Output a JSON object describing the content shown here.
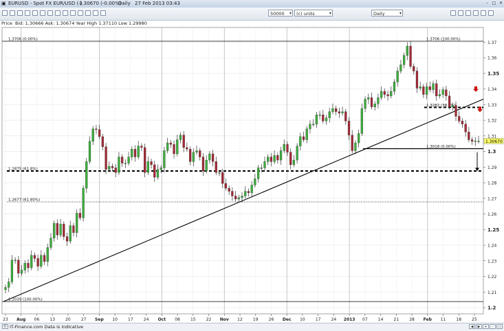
{
  "window": {
    "title": "EURUSD - Spot FX EUR/USD (-)",
    "price_info": "1.30670 (-0.00%)",
    "timeframe": "Daily",
    "datetime": "27 Feb 2013 03:43"
  },
  "toolbar": {
    "quantity_value": "50000",
    "units_value": "(c) units",
    "interval_value": "Daily"
  },
  "infobar": {
    "price_label": "Price",
    "quote_text": "Bid: 1.30666 Ask: 1.30674 Year High 1.37110 Low 1.29980"
  },
  "footer": {
    "source_text": "IT-Finance.com  Data is indicative"
  },
  "colors": {
    "up_candle": "#3dae3d",
    "down_candle": "#a42a36",
    "price_tag": "#ffff66",
    "arrow": "#cc1111"
  },
  "chart_data": {
    "type": "candlestick",
    "ylim": [
      1.2,
      1.375
    ],
    "yticks": [
      "1.37",
      "1.36",
      "1.35",
      "1.34",
      "1.33",
      "1.32",
      "1.31",
      "1.3",
      "1.29",
      "1.28",
      "1.27",
      "1.26",
      "1.25",
      "1.24",
      "1.23",
      "1.22",
      "1.21",
      "1.2"
    ],
    "bold_yticks": [
      "1.35",
      "1.3",
      "1.25",
      "1.2"
    ],
    "x_labels": [
      "23",
      "Aug",
      "06",
      "13",
      "20",
      "27",
      "Sep",
      "10",
      "17",
      "24",
      "Oct",
      "08",
      "15",
      "22",
      "Nov",
      "12",
      "19",
      "26",
      "Dec",
      "10",
      "17",
      "24",
      "2013",
      "07",
      "14",
      "21",
      "28",
      "Feb",
      "11",
      "18",
      "25"
    ],
    "last_price": "1.30670",
    "candles": {
      "open": [
        1.2115,
        1.213,
        1.2165,
        1.2305,
        1.2305,
        1.222,
        1.224,
        1.2285,
        1.2255,
        1.2335,
        1.2315,
        1.2265,
        1.2335,
        1.2295,
        1.2385,
        1.2445,
        1.254,
        1.2465,
        1.2535,
        1.2455,
        1.2425,
        1.2525,
        1.248,
        1.2605,
        1.2575,
        1.2765,
        1.2935,
        1.3065,
        1.3145,
        1.314,
        1.3095,
        1.303,
        1.2885,
        1.2905,
        1.2895,
        1.2865,
        1.2965,
        1.2925,
        1.2925,
        1.2965,
        1.3015,
        1.2965,
        1.3035,
        1.3025,
        1.2865,
        1.2935,
        1.2915,
        1.2835,
        1.2885,
        1.2895,
        1.3005,
        1.3055,
        1.3045,
        1.2985,
        1.3075,
        1.3105,
        1.3025,
        1.3015,
        1.2935,
        1.2995,
        1.3005,
        1.2965,
        1.2875,
        1.2945,
        1.2985,
        1.2935,
        1.2865,
        1.2865,
        1.2795,
        1.2765,
        1.2745,
        1.2715,
        1.2695,
        1.2705,
        1.2715,
        1.2745,
        1.2735,
        1.2785,
        1.2825,
        1.2895,
        1.2895,
        1.2935,
        1.2965,
        1.2935,
        1.2975,
        1.2945,
        1.3005,
        1.3045,
        1.2995,
        1.2915,
        1.2945,
        1.3035,
        1.3095,
        1.3075,
        1.3145,
        1.3175,
        1.3175,
        1.3235,
        1.3235,
        1.3195,
        1.3215,
        1.3255,
        1.3275,
        1.3255,
        1.3245,
        1.3255,
        1.3195,
        1.3105,
        1.3005,
        1.3055,
        1.3115,
        1.3275,
        1.3335,
        1.3345,
        1.3285,
        1.3305,
        1.3345,
        1.3385,
        1.3365,
        1.3355,
        1.3385,
        1.3445,
        1.3515,
        1.3555,
        1.3615,
        1.3675,
        1.3545,
        1.3515,
        1.3405,
        1.3415,
        1.3365,
        1.3415,
        1.3395,
        1.3435,
        1.3355,
        1.3365,
        1.3395,
        1.3355,
        1.3285,
        1.3295,
        1.3225,
        1.3195,
        1.3175,
        1.3125,
        1.3075,
        1.3065,
        1.3067
      ],
      "close": [
        1.213,
        1.2165,
        1.2305,
        1.2305,
        1.222,
        1.224,
        1.2285,
        1.2255,
        1.2335,
        1.2315,
        1.2265,
        1.2335,
        1.2295,
        1.2385,
        1.2445,
        1.254,
        1.2465,
        1.2535,
        1.2455,
        1.2425,
        1.2525,
        1.248,
        1.2605,
        1.2575,
        1.2765,
        1.2935,
        1.3065,
        1.3145,
        1.314,
        1.3095,
        1.303,
        1.2885,
        1.2905,
        1.2895,
        1.2865,
        1.2965,
        1.2925,
        1.2925,
        1.2965,
        1.3015,
        1.2965,
        1.3035,
        1.3025,
        1.2865,
        1.2935,
        1.2915,
        1.2835,
        1.2885,
        1.2895,
        1.3005,
        1.3055,
        1.3045,
        1.2985,
        1.3075,
        1.3105,
        1.3025,
        1.3015,
        1.2935,
        1.2995,
        1.3005,
        1.2965,
        1.2875,
        1.2945,
        1.2985,
        1.2935,
        1.2865,
        1.2865,
        1.2795,
        1.2765,
        1.2745,
        1.2715,
        1.2695,
        1.2705,
        1.2715,
        1.2745,
        1.2735,
        1.2785,
        1.2825,
        1.2895,
        1.2895,
        1.2935,
        1.2965,
        1.2935,
        1.2975,
        1.2945,
        1.3005,
        1.3045,
        1.2995,
        1.2915,
        1.2945,
        1.3035,
        1.3095,
        1.3075,
        1.3145,
        1.3175,
        1.3175,
        1.3235,
        1.3235,
        1.3195,
        1.3215,
        1.3255,
        1.3275,
        1.3255,
        1.3245,
        1.3255,
        1.3195,
        1.3105,
        1.3005,
        1.3055,
        1.3115,
        1.3275,
        1.3335,
        1.3345,
        1.3285,
        1.3305,
        1.3345,
        1.3385,
        1.3365,
        1.3355,
        1.3385,
        1.3445,
        1.3515,
        1.3555,
        1.3615,
        1.3675,
        1.3545,
        1.3515,
        1.3405,
        1.3415,
        1.3365,
        1.3415,
        1.3395,
        1.3435,
        1.3355,
        1.3365,
        1.3395,
        1.3355,
        1.3285,
        1.3295,
        1.3225,
        1.3195,
        1.3175,
        1.3125,
        1.3075,
        1.3065,
        1.3067,
        1.3067
      ]
    },
    "horizontal_levels": [
      {
        "label": "1.3706 (0.00%)",
        "value": 1.3706,
        "label_side": "left",
        "style": "solid"
      },
      {
        "label": "1.3706 (100.00%)",
        "value": 1.3706,
        "label_side": "right",
        "style": "solid"
      },
      {
        "label": "1.3282 (38.2%)",
        "value": 1.3282,
        "label_side": "right",
        "style": "dashed-bold"
      },
      {
        "label": "1.3018 (0.00%)",
        "value": 1.3018,
        "label_side": "right",
        "style": "solid"
      },
      {
        "label": "1.2875 (61.8%)",
        "value": 1.2875,
        "label_side": "left",
        "style": "dashed-bold"
      },
      {
        "label": "1.2677 (61.80%)",
        "value": 1.2677,
        "label_side": "left",
        "style": "dotted"
      },
      {
        "label": "1.2039 (100.00%)",
        "value": 1.2039,
        "label_side": "left",
        "style": "solid"
      }
    ],
    "trendline": {
      "start": [
        "23 Jul",
        1.2039
      ],
      "end": [
        "27 Feb",
        1.3335
      ]
    },
    "annotations": [
      "down-arrow-1",
      "down-arrow-2",
      "projection-arrow"
    ]
  }
}
